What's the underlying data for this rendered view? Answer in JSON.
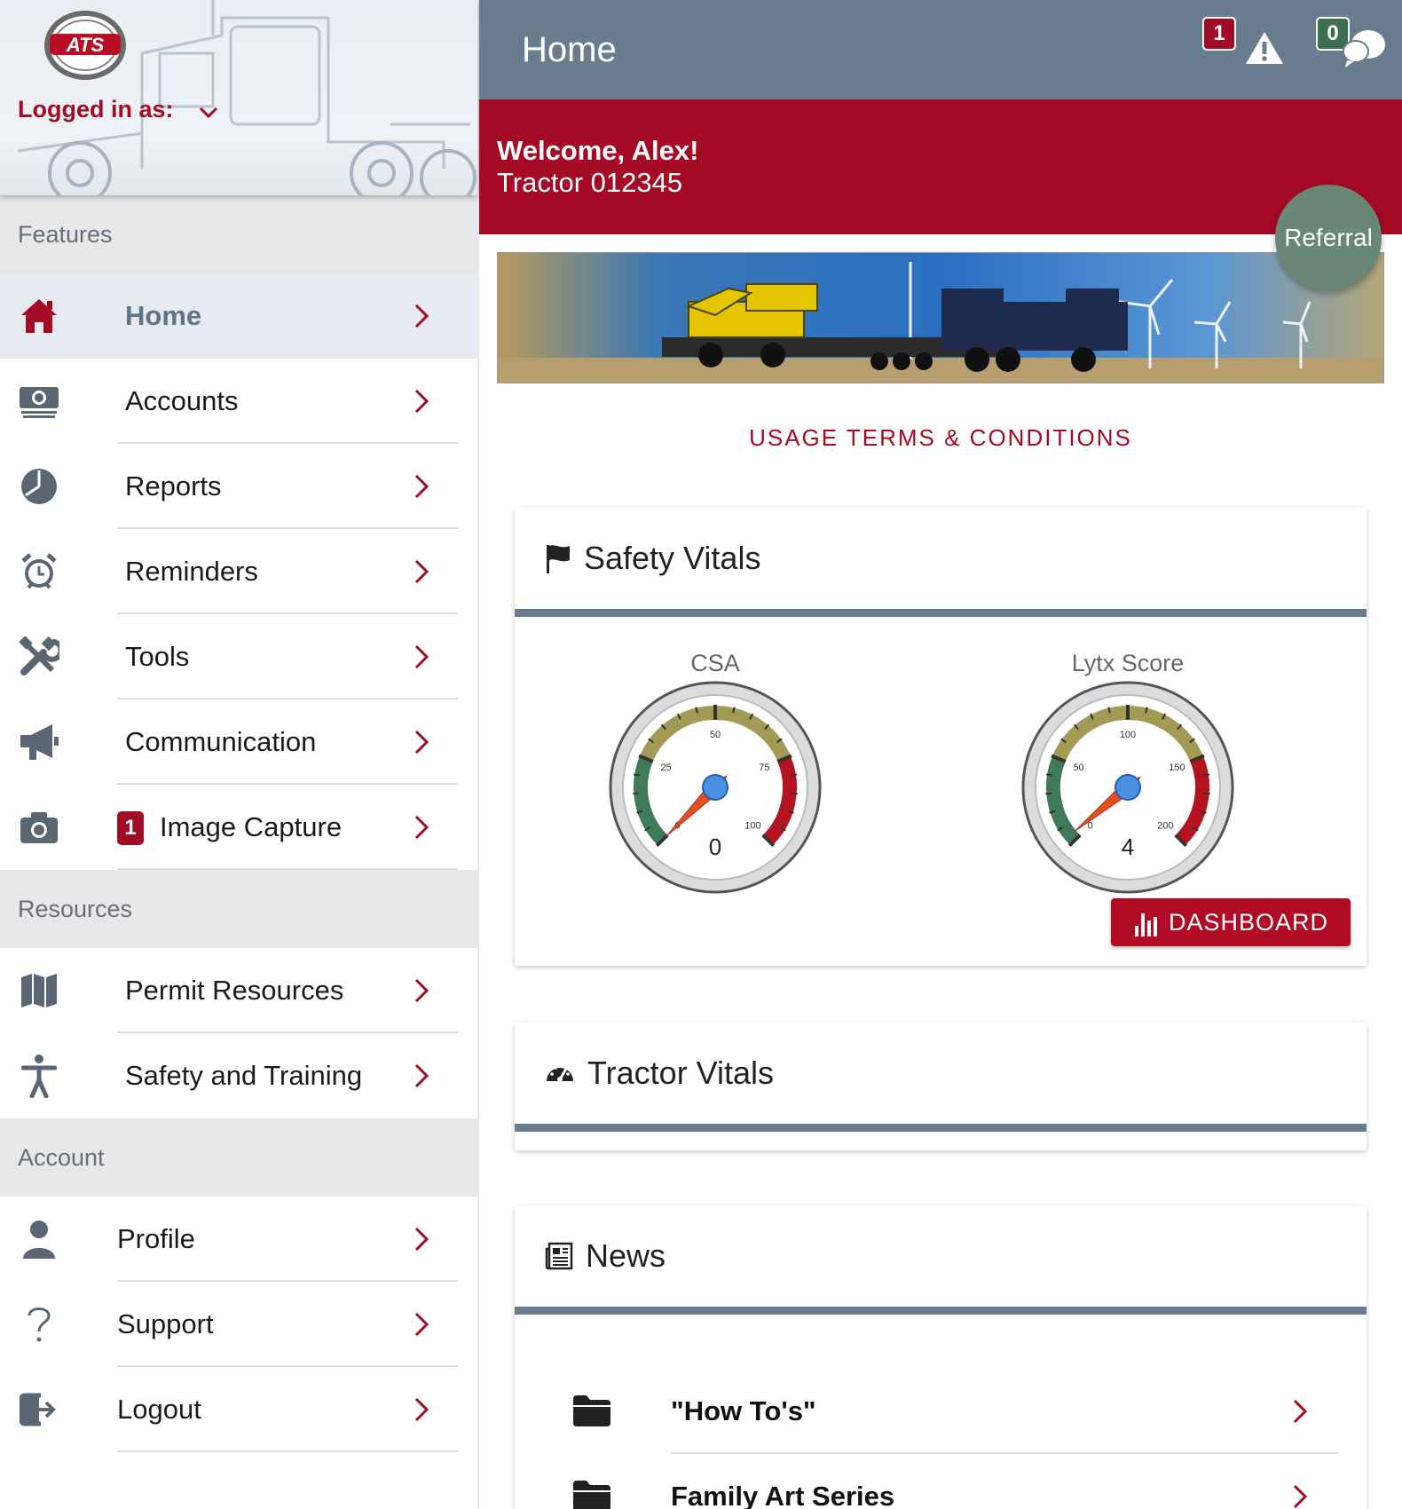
{
  "sidebar": {
    "logo_text": "ATS",
    "logged_in_label": "Logged in as:",
    "sections": {
      "features": "Features",
      "resources": "Resources",
      "account": "Account"
    },
    "features": [
      {
        "label": "Home",
        "icon": "home-icon",
        "active": true
      },
      {
        "label": "Accounts",
        "icon": "money-icon"
      },
      {
        "label": "Reports",
        "icon": "pie-chart-icon"
      },
      {
        "label": "Reminders",
        "icon": "alarm-clock-icon"
      },
      {
        "label": "Tools",
        "icon": "tools-icon"
      },
      {
        "label": "Communication",
        "icon": "megaphone-icon"
      },
      {
        "label": "Image Capture",
        "icon": "camera-icon",
        "badge": "1"
      }
    ],
    "resources": [
      {
        "label": "Permit Resources",
        "icon": "map-icon"
      },
      {
        "label": "Safety and Training",
        "icon": "person-icon"
      }
    ],
    "account": [
      {
        "label": "Profile",
        "icon": "user-icon"
      },
      {
        "label": "Support",
        "icon": "question-icon"
      },
      {
        "label": "Logout",
        "icon": "logout-icon"
      }
    ]
  },
  "topbar": {
    "title": "Home",
    "alert_count": "1",
    "message_count": "0"
  },
  "welcome": {
    "greeting": "Welcome, Alex!",
    "tractor": "Tractor 012345",
    "referral_label": "Referral"
  },
  "terms_link": "USAGE TERMS & CONDITIONS",
  "safety_vitals": {
    "title": "Safety Vitals",
    "gauges": [
      {
        "label": "CSA",
        "value": 0,
        "display": "0",
        "min": 0,
        "max": 100,
        "ticks": [
          "0",
          "25",
          "50",
          "75",
          "100"
        ]
      },
      {
        "label": "Lytx Score",
        "value": 4,
        "display": "4",
        "min": 0,
        "max": 200,
        "ticks": [
          "0",
          "50",
          "100",
          "150",
          "200"
        ]
      }
    ],
    "dashboard_label": "DASHBOARD"
  },
  "tractor_vitals": {
    "title": "Tractor Vitals"
  },
  "news": {
    "title": "News",
    "items": [
      {
        "label": "\"How To's\""
      },
      {
        "label": "Family Art Series"
      }
    ]
  },
  "colors": {
    "brand_red": "#a50a24",
    "header_slate": "#6a7d8f",
    "gauge_green": "#3f7a5a",
    "gauge_gold": "#a39a55",
    "gauge_red": "#b3141f"
  }
}
